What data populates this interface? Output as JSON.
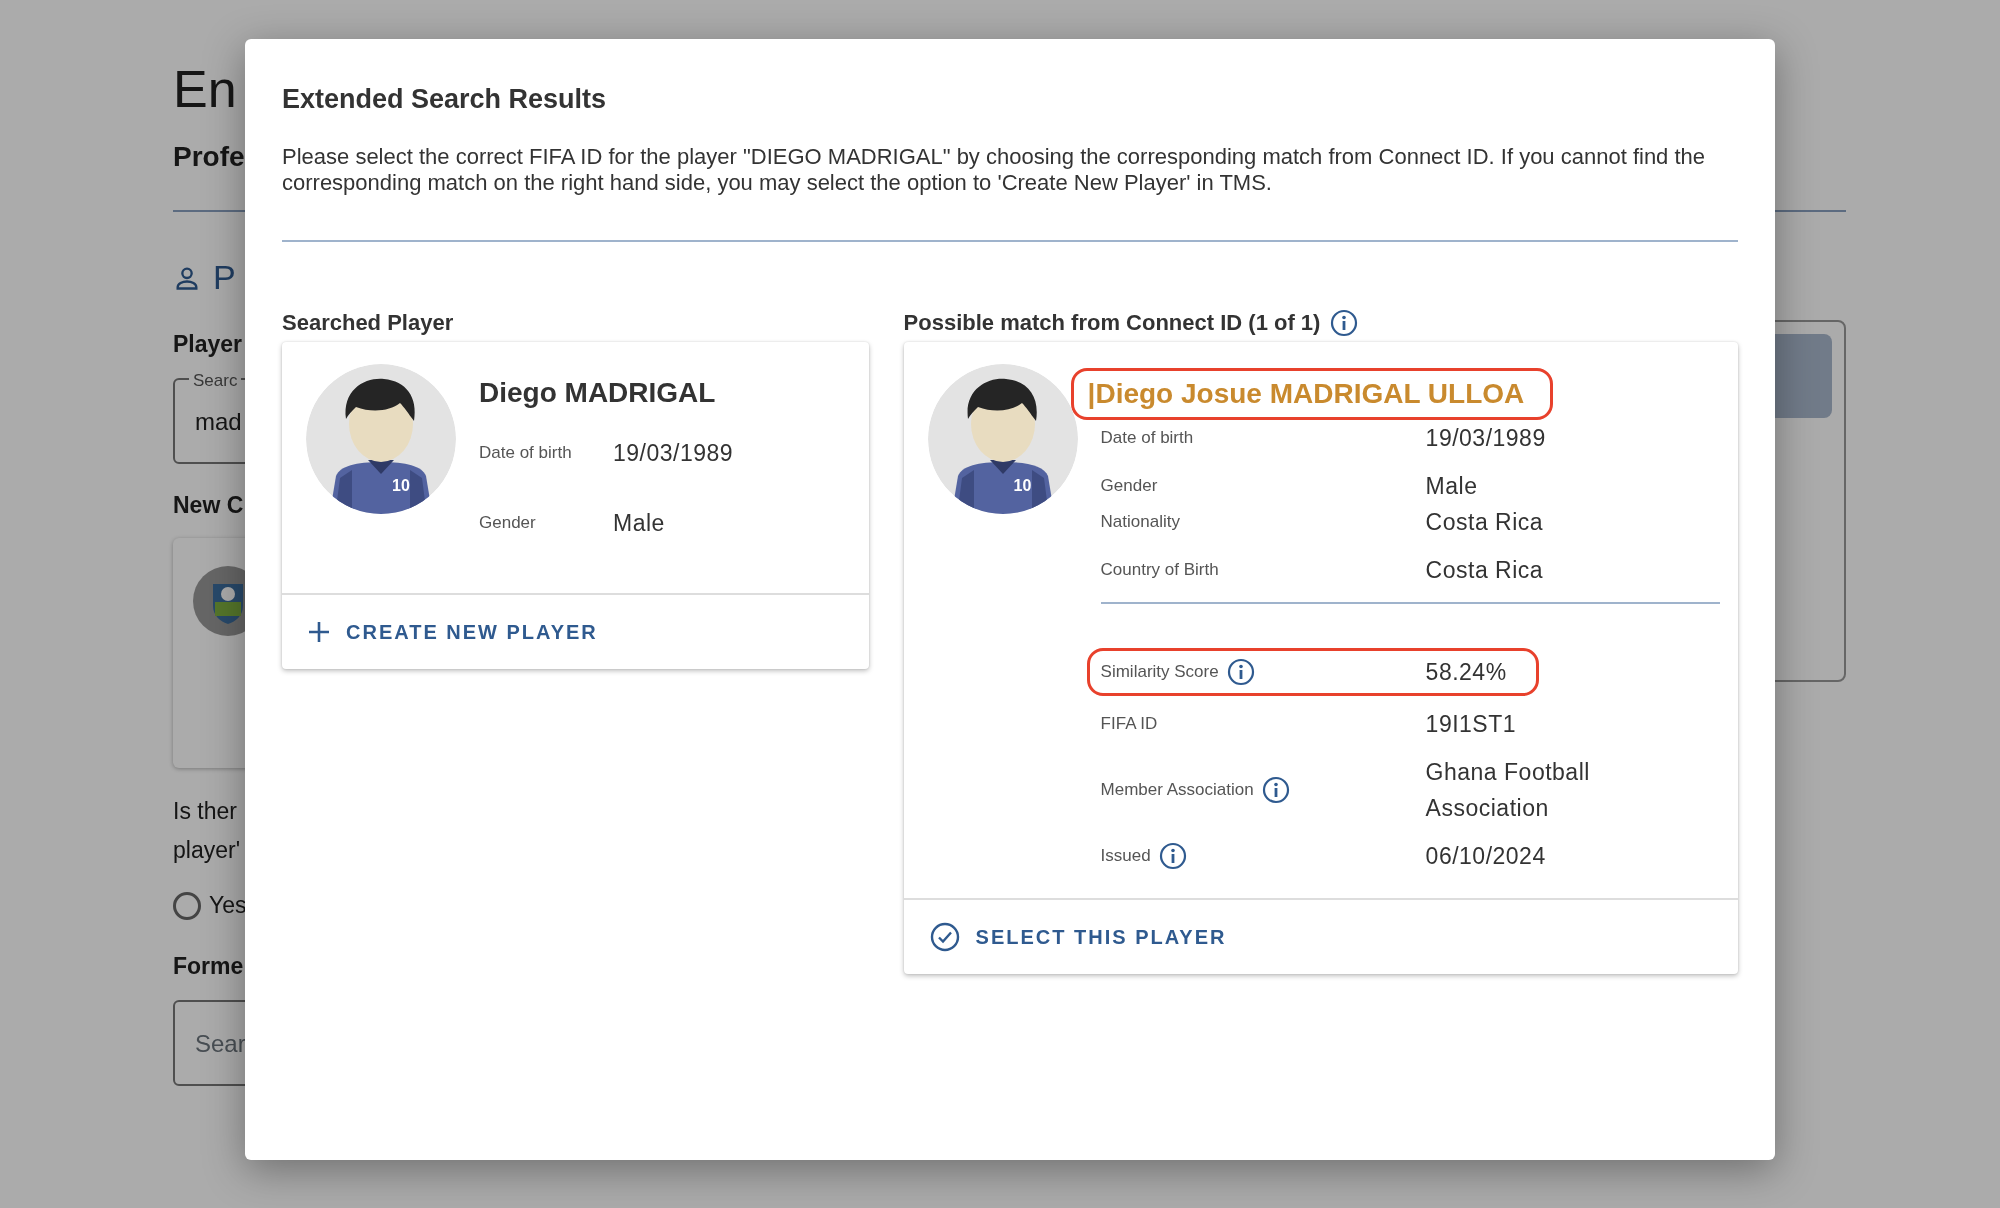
{
  "background": {
    "heading": "En",
    "subheading": "Profe",
    "section": "P",
    "player_label": "Player",
    "search_field": {
      "label": "Searc",
      "value": "mad"
    },
    "new_club_label": "New C",
    "question": [
      "Is ther",
      "player'"
    ],
    "radio": {
      "label": "Yes",
      "selected": false
    },
    "former_label": "Forme",
    "former_field": {
      "placeholder": "Sear"
    }
  },
  "modal": {
    "title": "Extended Search Results",
    "description": "Please select the correct FIFA ID for the player \"DIEGO MADRIGAL\" by choosing the corresponding match from Connect ID. If you cannot find the corresponding match on the right hand side, you may select the option to 'Create New Player' in TMS.",
    "searched": {
      "heading": "Searched Player",
      "player": {
        "jersey": "10",
        "name": "Diego MADRIGAL",
        "highlighted": false,
        "fields": [
          {
            "label": "Date of birth",
            "value": "19/03/1989"
          },
          {
            "label": "Gender",
            "value": "Male"
          }
        ]
      },
      "action": "CREATE NEW PLAYER"
    },
    "match": {
      "heading": "Possible match from Connect ID (1 of 1)",
      "player": {
        "jersey": "10",
        "name": "|Diego Josue MADRIGAL ULLOA",
        "highlighted": true,
        "fields": [
          {
            "label": "Date of birth",
            "value": "19/03/1989",
            "info": false,
            "highlighted": false
          },
          {
            "label": "Gender",
            "value": "Male",
            "info": false,
            "highlighted": false
          },
          {
            "label": "Nationality",
            "value": "Costa Rica",
            "info": false,
            "highlighted": false
          },
          {
            "label": "Country of Birth",
            "value": "Costa Rica",
            "info": false,
            "highlighted": false
          }
        ],
        "details": [
          {
            "label": "Similarity Score",
            "value": "58.24%",
            "info": true,
            "highlighted": true
          },
          {
            "label": "FIFA ID",
            "value": "19I1ST1",
            "info": false,
            "highlighted": false
          },
          {
            "label": "Member Association",
            "value": "Ghana Football Association",
            "info": true,
            "highlighted": false
          },
          {
            "label": "Issued",
            "value": "06/10/2024",
            "info": true,
            "highlighted": false
          }
        ]
      },
      "action": "SELECT THIS PLAYER"
    }
  }
}
